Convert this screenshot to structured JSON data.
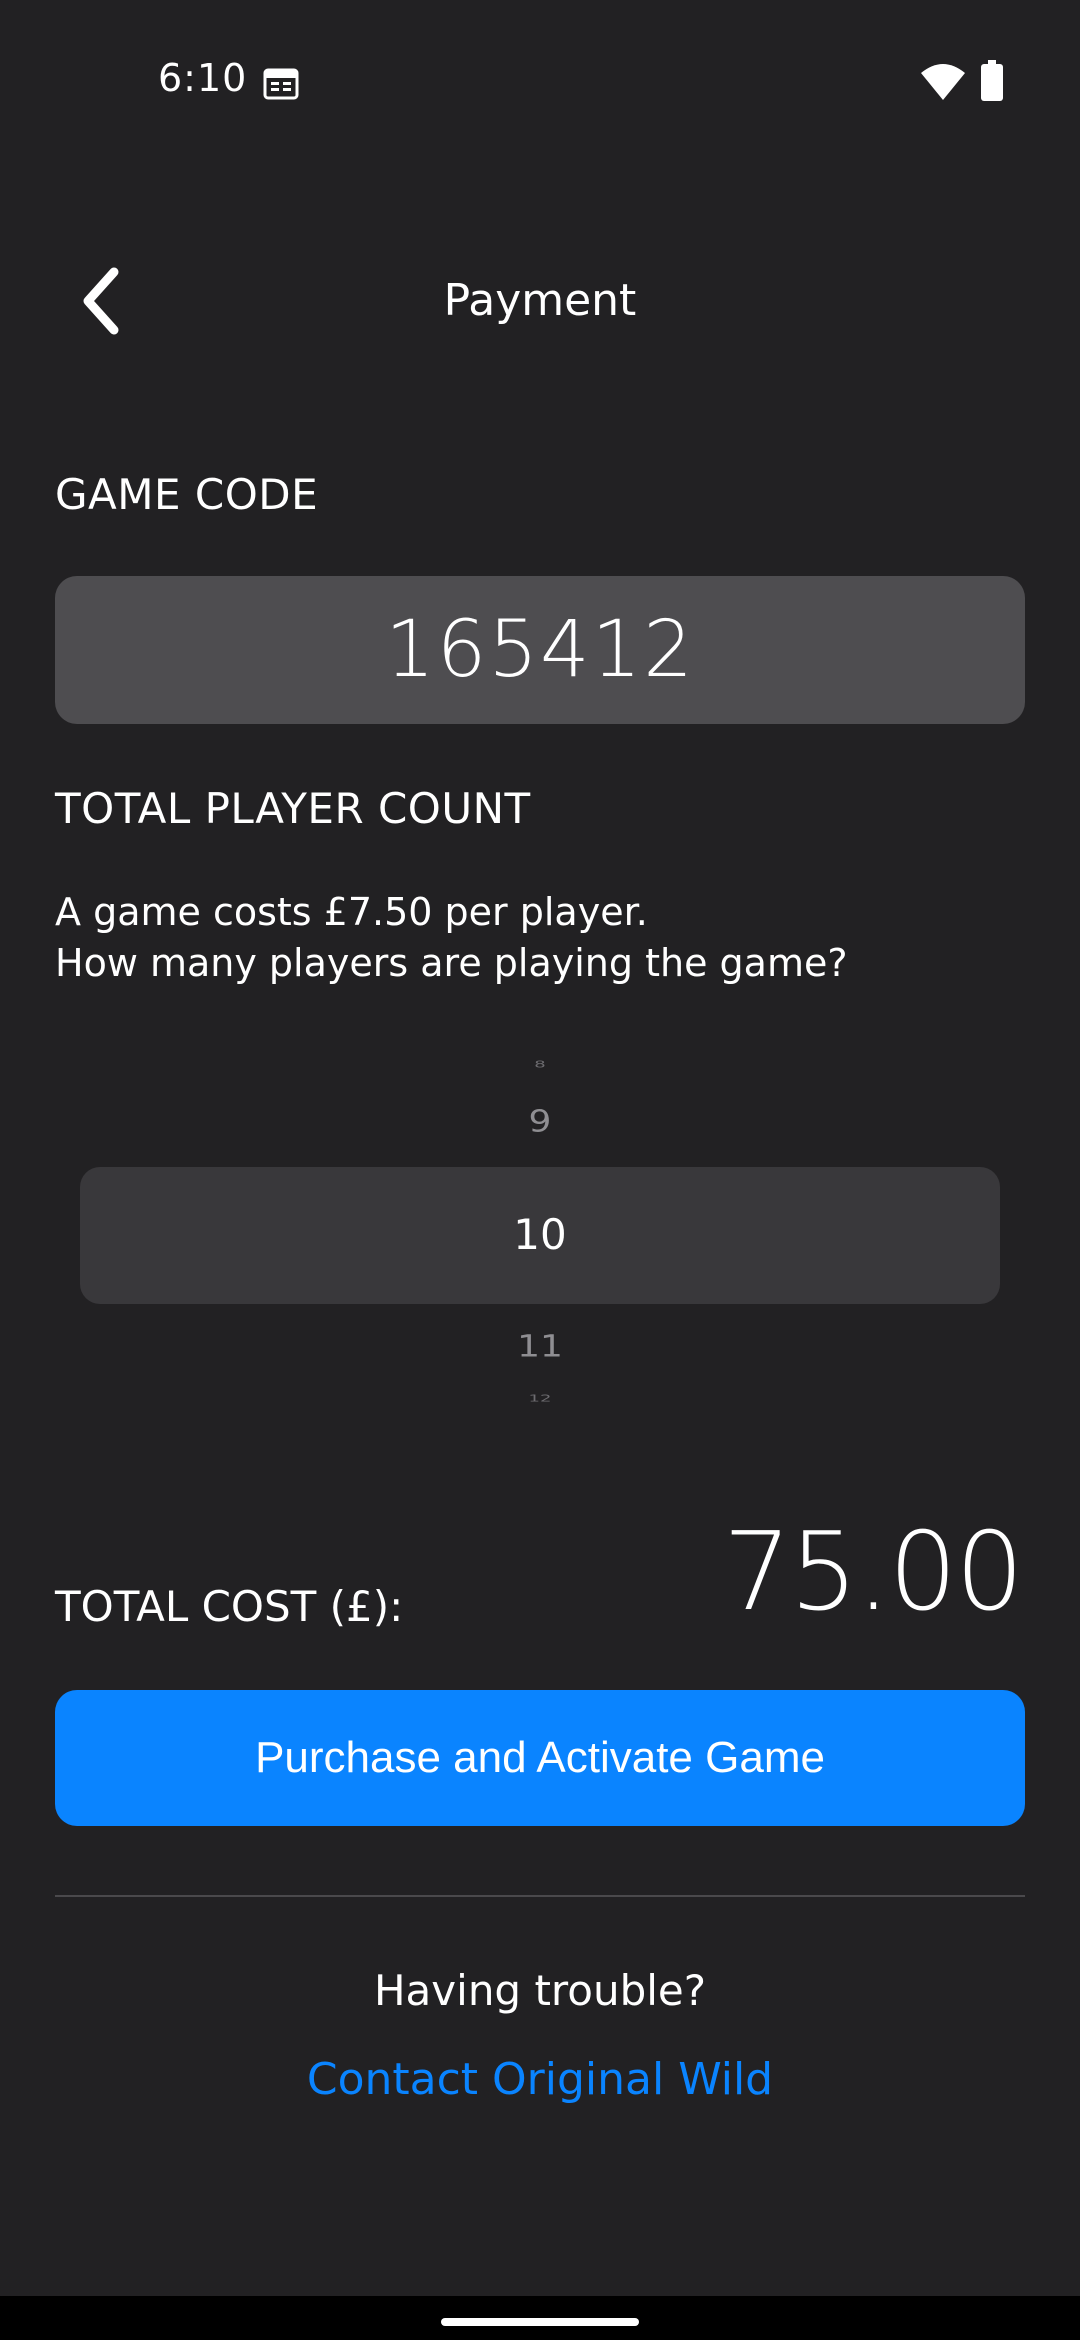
{
  "status_bar": {
    "time": "6:10",
    "icons": [
      "calendar-icon",
      "wifi-icon",
      "battery-icon"
    ]
  },
  "header": {
    "back_icon": "chevron-left-icon",
    "title": "Payment"
  },
  "game_code": {
    "label": "GAME CODE",
    "value": "165412"
  },
  "player_count": {
    "label": "TOTAL PLAYER COUNT",
    "description_line1": "A game costs £7.50 per player.",
    "description_line2": "How many players are playing the game?",
    "picker_items": [
      "8",
      "9",
      "10",
      "11",
      "12"
    ],
    "selected": "10"
  },
  "total": {
    "label": "TOTAL COST (£):",
    "value": "75.00"
  },
  "purchase_button": {
    "label": "Purchase and Activate Game"
  },
  "help": {
    "prompt": "Having trouble?",
    "link": "Contact Original Wild"
  },
  "colors": {
    "background": "#222123",
    "accent": "#0a84ff",
    "field": "#4e4d50"
  }
}
